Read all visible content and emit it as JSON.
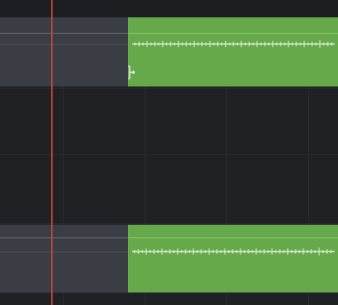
{
  "colors": {
    "background": "#202125",
    "clip_fill": "#66a94a",
    "clip_edge": "#7fc55f",
    "waveform": "#f2f7ee",
    "pre_region": "#3a3d44",
    "playhead": "#c8453b"
  },
  "tracks": [
    {
      "name": "audio-track-1",
      "clip": {
        "type": "audio-clip",
        "color": "#66a94a"
      }
    },
    {
      "name": "audio-track-2",
      "clip": {
        "type": "audio-clip",
        "color": "#66a94a"
      }
    }
  ],
  "icons": {
    "playhead": "playhead-line",
    "cursor": "trim-cursor-icon"
  }
}
